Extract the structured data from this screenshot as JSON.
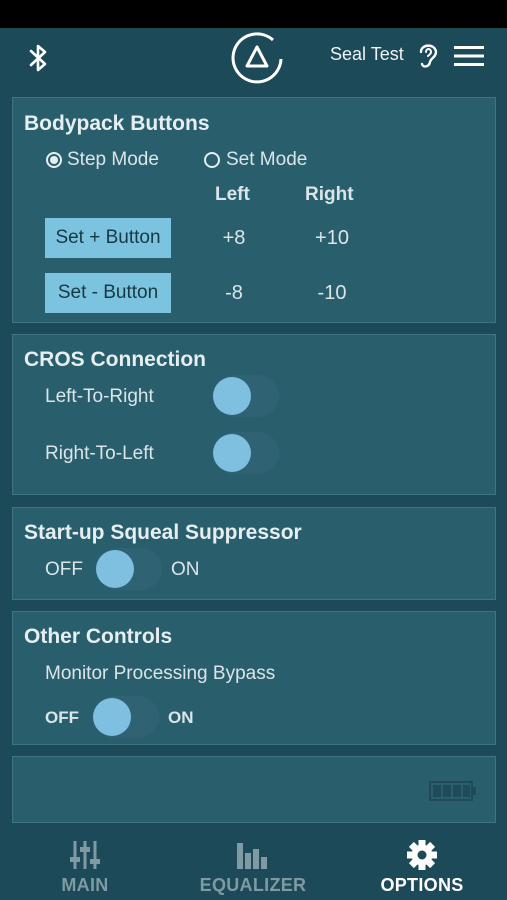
{
  "header": {
    "seal_label": "Seal Test",
    "icons": [
      "bluetooth-icon",
      "logo-triangle-icon",
      "ear-icon",
      "hamburger-menu-icon"
    ]
  },
  "bodypack": {
    "title": "Bodypack Buttons",
    "step_mode_label": "Step Mode",
    "set_mode_label": "Set Mode",
    "selected_mode": "Step Mode",
    "col_left": "Left",
    "col_right": "Right",
    "rows": [
      {
        "button": "Set + Button",
        "left": "+8",
        "right": "+10"
      },
      {
        "button": "Set - Button",
        "left": "-8",
        "right": "-10"
      }
    ]
  },
  "cros": {
    "title": "CROS Connection",
    "left_to_right_label": "Left-To-Right",
    "right_to_left_label": "Right-To-Left",
    "left_to_right_on": false,
    "right_to_left_on": false
  },
  "squeal": {
    "title": "Start-up Squeal Suppressor",
    "off_label": "OFF",
    "on_label": "ON",
    "enabled": false
  },
  "other": {
    "title": "Other Controls",
    "bypass_label": "Monitor Processing Bypass",
    "off_label": "OFF",
    "on_label": "ON",
    "enabled": false
  },
  "status": {
    "battery_icon": "battery-icon"
  },
  "tabs": [
    {
      "label": "MAIN",
      "icon": "sliders-icon",
      "active": false
    },
    {
      "label": "EQUALIZER",
      "icon": "equalizer-bars-icon",
      "active": false
    },
    {
      "label": "OPTIONS",
      "icon": "gear-icon",
      "active": true
    }
  ],
  "colors": {
    "background": "#1c4a58",
    "panel": "#295e6d",
    "button": "#7cc3df",
    "toggle_knob": "#7fbfe0",
    "tab_active": "#ffffff",
    "tab_inactive": "#7f9aa3"
  }
}
